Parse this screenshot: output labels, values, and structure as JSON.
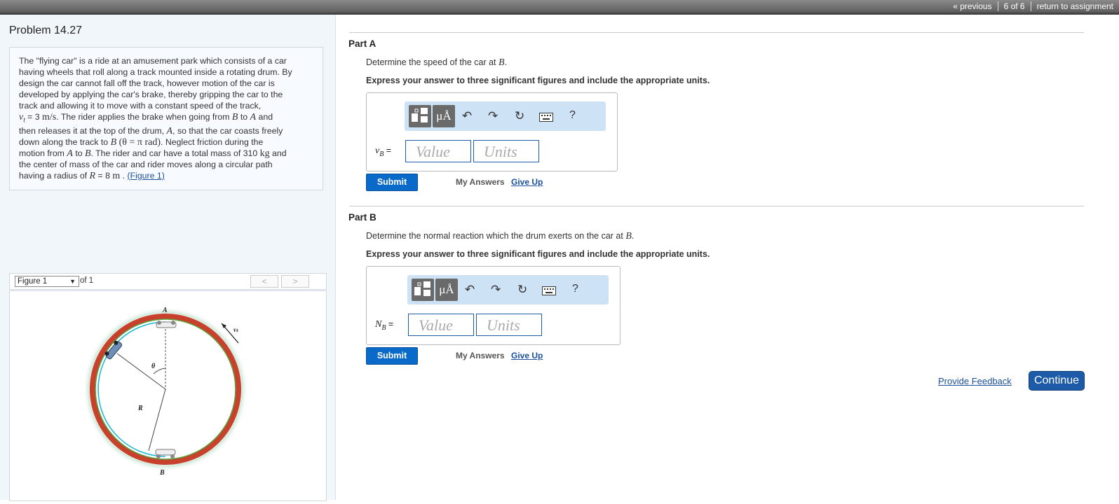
{
  "topnav": {
    "previous": "« previous",
    "count": "6 of 6",
    "return": "return to assignment"
  },
  "problem": {
    "title": "Problem 14.27",
    "desc": {
      "l1": "The \"flying car\" is a ride at an amusement park which consists of a car",
      "l2": "having wheels that roll along a track mounted inside a rotating drum. By",
      "l3": "design the car cannot fall off the track, however motion of the car is",
      "l4": "developed by applying the car's brake, thereby gripping the car to the",
      "l5": "track and allowing it to move with a constant speed of the track,",
      "l6a": "v",
      "l6sub": "t",
      "l6b": " = 3 ",
      "l6unit": "m/s",
      "l6c": ". The rider applies the brake when going from ",
      "l6B": "B",
      "l6d": " to ",
      "l6A": "A",
      "l6e": " and",
      "l7a": "then releases it at the top of the drum, ",
      "l7A": "A",
      "l7b": ", so that the car coasts freely",
      "l8a": "down along the track to ",
      "l8B": "B",
      "l8eq": " (θ = π rad)",
      "l8b": ". Neglect friction during the",
      "l9a": "motion from ",
      "l9A": "A",
      "l9b": " to ",
      "l9B": "B",
      "l9c": ". The rider and car have a total mass of 310 ",
      "l9unit": "kg",
      "l9d": " and",
      "l10": "the center of mass of the car and rider moves along a circular path",
      "l11a": "having a radius of ",
      "l11R": "R",
      "l11b": " = 8 ",
      "l11unit": "m",
      "l11c": " . ",
      "l11link": "(Figure 1)"
    }
  },
  "figure": {
    "select": "Figure 1",
    "of": "of 1",
    "prev": "<",
    "next": ">",
    "labels": {
      "A": "A",
      "B": "B",
      "R": "R",
      "theta": "θ",
      "vt": "vₜ"
    }
  },
  "partA": {
    "heading": "Part A",
    "prompt_pre": "Determine the speed of the car at ",
    "prompt_var": "B",
    "prompt_post": ".",
    "express": "Express your answer to three significant figures and include the appropriate units.",
    "var_main": "v",
    "var_sub": "B",
    "eq": " =",
    "value_placeholder": "Value",
    "units_placeholder": "Units",
    "submit": "Submit",
    "my_answers": "My Answers",
    "give_up": "Give Up"
  },
  "partB": {
    "heading": "Part B",
    "prompt_pre": "Determine the normal reaction which the drum exerts on the car at ",
    "prompt_var": "B",
    "prompt_post": ".",
    "express": "Express your answer to three significant figures and include the appropriate units.",
    "var_main": "N",
    "var_sub": "B",
    "eq": " =",
    "value_placeholder": "Value",
    "units_placeholder": "Units",
    "submit": "Submit",
    "my_answers": "My Answers",
    "give_up": "Give Up"
  },
  "toolbar": {
    "units_label": "μÅ",
    "help": "?"
  },
  "footer": {
    "feedback": "Provide Feedback",
    "continue": "Continue"
  }
}
